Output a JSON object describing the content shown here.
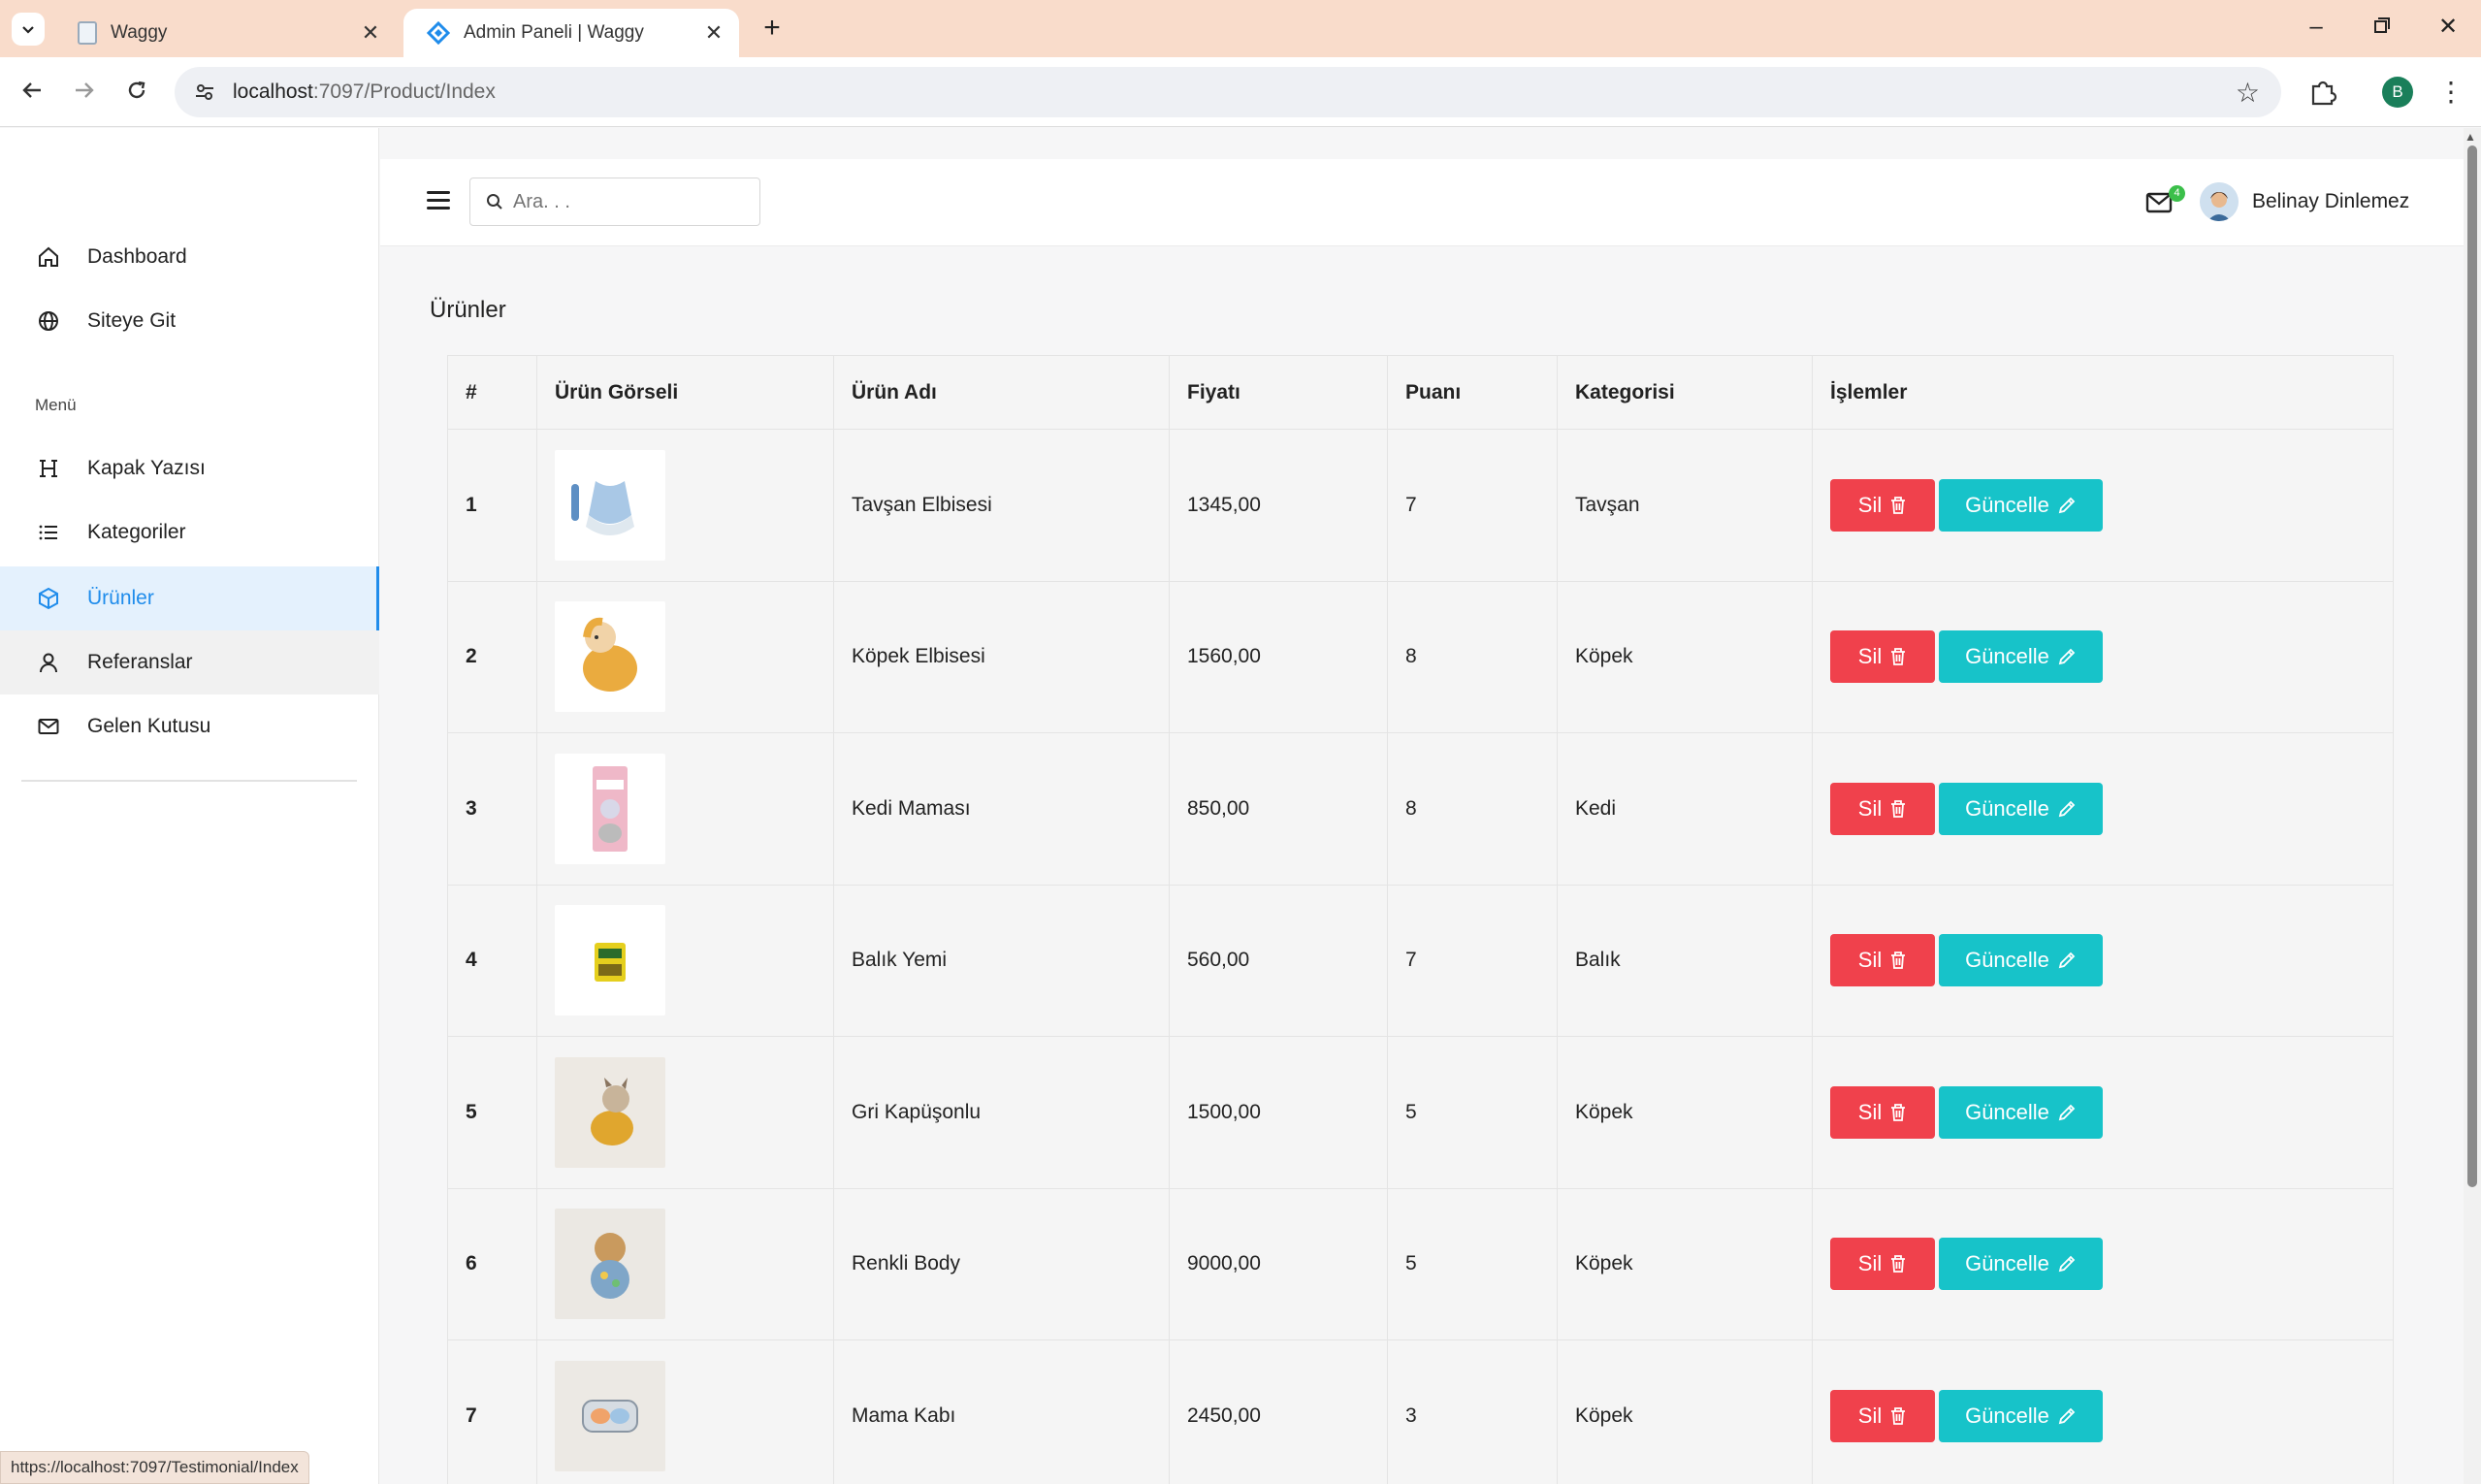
{
  "browser": {
    "tabs": [
      {
        "title": "Waggy",
        "active": false
      },
      {
        "title": "Admin Paneli | Waggy",
        "active": true
      }
    ],
    "url_host": "localhost",
    "url_path": ":7097/Product/Index",
    "profile_initial": "B",
    "status_url": "https://localhost:7097/Testimonial/Index"
  },
  "sidebar": {
    "top_items": [
      {
        "label": "Dashboard",
        "icon": "home-icon"
      },
      {
        "label": "Siteye Git",
        "icon": "globe-icon"
      }
    ],
    "heading": "Menü",
    "menu_items": [
      {
        "label": "Kapak Yazısı",
        "icon": "heading-icon"
      },
      {
        "label": "Kategoriler",
        "icon": "list-icon"
      },
      {
        "label": "Ürünler",
        "icon": "box-icon",
        "active": true
      },
      {
        "label": "Referanslar",
        "icon": "user-icon",
        "hover": true
      },
      {
        "label": "Gelen Kutusu",
        "icon": "mail-icon"
      }
    ]
  },
  "topbar": {
    "search_placeholder": "Ara. . .",
    "mail_badge": "4",
    "user_name": "Belinay Dinlemez"
  },
  "page": {
    "title": "Ürünler",
    "columns": [
      "#",
      "Ürün Görseli",
      "Ürün Adı",
      "Fiyatı",
      "Puanı",
      "Kategorisi",
      "İşlemler"
    ],
    "delete_label": "Sil",
    "update_label": "Güncelle",
    "rows": [
      {
        "no": "1",
        "name": "Tavşan Elbisesi",
        "price": "1345,00",
        "rating": "7",
        "category": "Tavşan",
        "image": "blue-dress-thumb"
      },
      {
        "no": "2",
        "name": "Köpek Elbisesi",
        "price": "1560,00",
        "rating": "8",
        "category": "Köpek",
        "image": "yellow-hoodie-dog-thumb"
      },
      {
        "no": "3",
        "name": "Kedi Maması",
        "price": "850,00",
        "rating": "8",
        "category": "Kedi",
        "image": "cat-food-bag-thumb"
      },
      {
        "no": "4",
        "name": "Balık Yemi",
        "price": "560,00",
        "rating": "7",
        "category": "Balık",
        "image": "fish-food-thumb"
      },
      {
        "no": "5",
        "name": "Gri Kapüşonlu",
        "price": "1500,00",
        "rating": "5",
        "category": "Köpek",
        "image": "bulldog-hoodie-thumb"
      },
      {
        "no": "6",
        "name": "Renkli Body",
        "price": "9000,00",
        "rating": "5",
        "category": "Köpek",
        "image": "colorful-body-dog-thumb"
      },
      {
        "no": "7",
        "name": "Mama Kabı",
        "price": "2450,00",
        "rating": "3",
        "category": "Köpek",
        "image": "food-bowl-thumb"
      }
    ]
  },
  "colors": {
    "accent": "#1f8ceb",
    "delete_button": "#f0414c",
    "update_button": "#17c3c9",
    "tabbar": "#f9dccb"
  }
}
